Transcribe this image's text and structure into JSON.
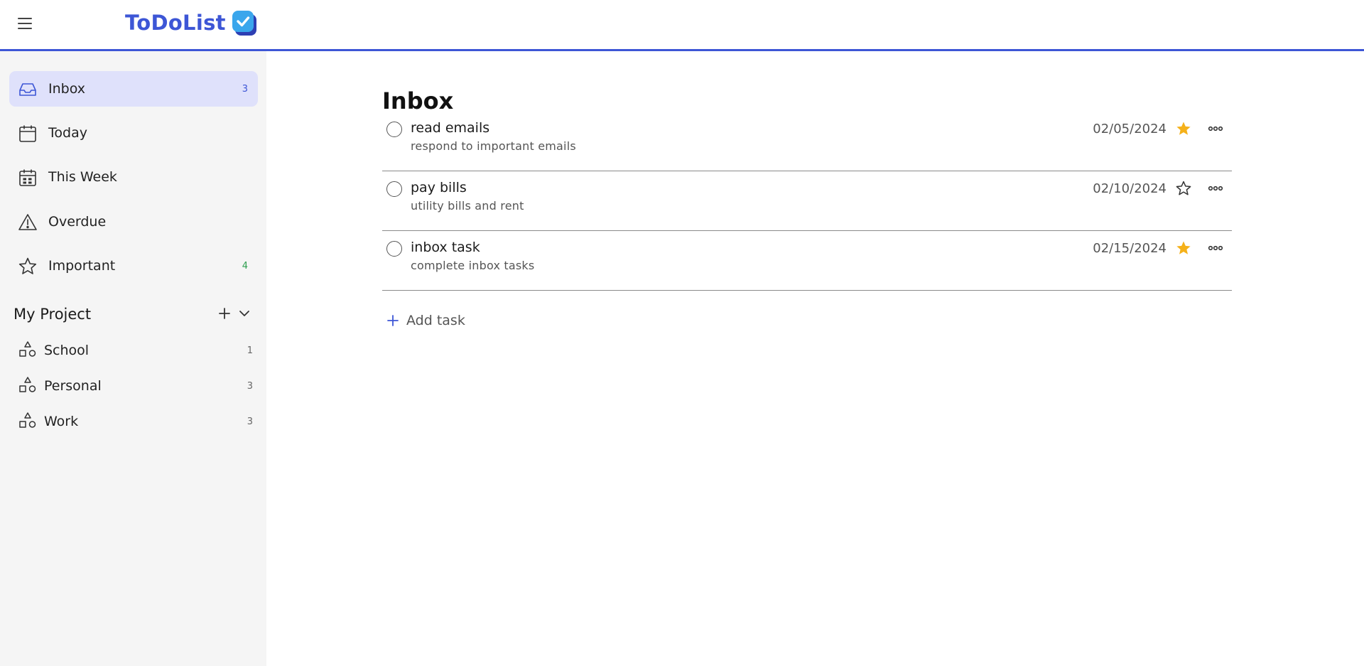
{
  "header": {
    "logo_text": "ToDoList",
    "accent_color": "#3d56d6"
  },
  "sidebar": {
    "items": [
      {
        "label": "Inbox",
        "count": "3",
        "icon": "inbox-icon",
        "active": true
      },
      {
        "label": "Today",
        "count": "",
        "icon": "calendar-icon"
      },
      {
        "label": "This Week",
        "count": "",
        "icon": "calendar-week-icon"
      },
      {
        "label": "Overdue",
        "count": "",
        "icon": "warning-icon"
      },
      {
        "label": "Important",
        "count": "4",
        "icon": "star-icon"
      }
    ],
    "project_section": {
      "title": "My Project",
      "projects": [
        {
          "label": "School",
          "count": "1",
          "icon": "shapes-icon"
        },
        {
          "label": "Personal",
          "count": "3",
          "icon": "shapes-icon"
        },
        {
          "label": "Work",
          "count": "3",
          "icon": "shapes-icon"
        }
      ]
    }
  },
  "main": {
    "title": "Inbox",
    "tasks": [
      {
        "title": "read emails",
        "description": "respond to important emails",
        "date": "02/05/2024",
        "important": true
      },
      {
        "title": "pay bills",
        "description": "utility bills and rent",
        "date": "02/10/2024",
        "important": false
      },
      {
        "title": "inbox task",
        "description": "complete inbox tasks",
        "date": "02/15/2024",
        "important": true
      }
    ],
    "add_task_label": "Add task",
    "star_color": "#f5b11a"
  }
}
